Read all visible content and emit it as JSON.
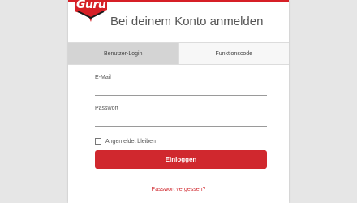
{
  "brand": {
    "logo_text": "Guru",
    "accent_color": "#d61f26"
  },
  "header": {
    "title": "Bei deinem Konto anmelden"
  },
  "tabs": [
    {
      "label": "Benutzer-Login",
      "active": true
    },
    {
      "label": "Funktionscode",
      "active": false
    }
  ],
  "form": {
    "email_label": "E-Mail",
    "email_value": "",
    "password_label": "Passwort",
    "password_value": "",
    "remember_label": "Angemeldet bleiben",
    "remember_checked": false,
    "submit_label": "Einloggen",
    "forgot_label": "Passwort vergessen?"
  }
}
